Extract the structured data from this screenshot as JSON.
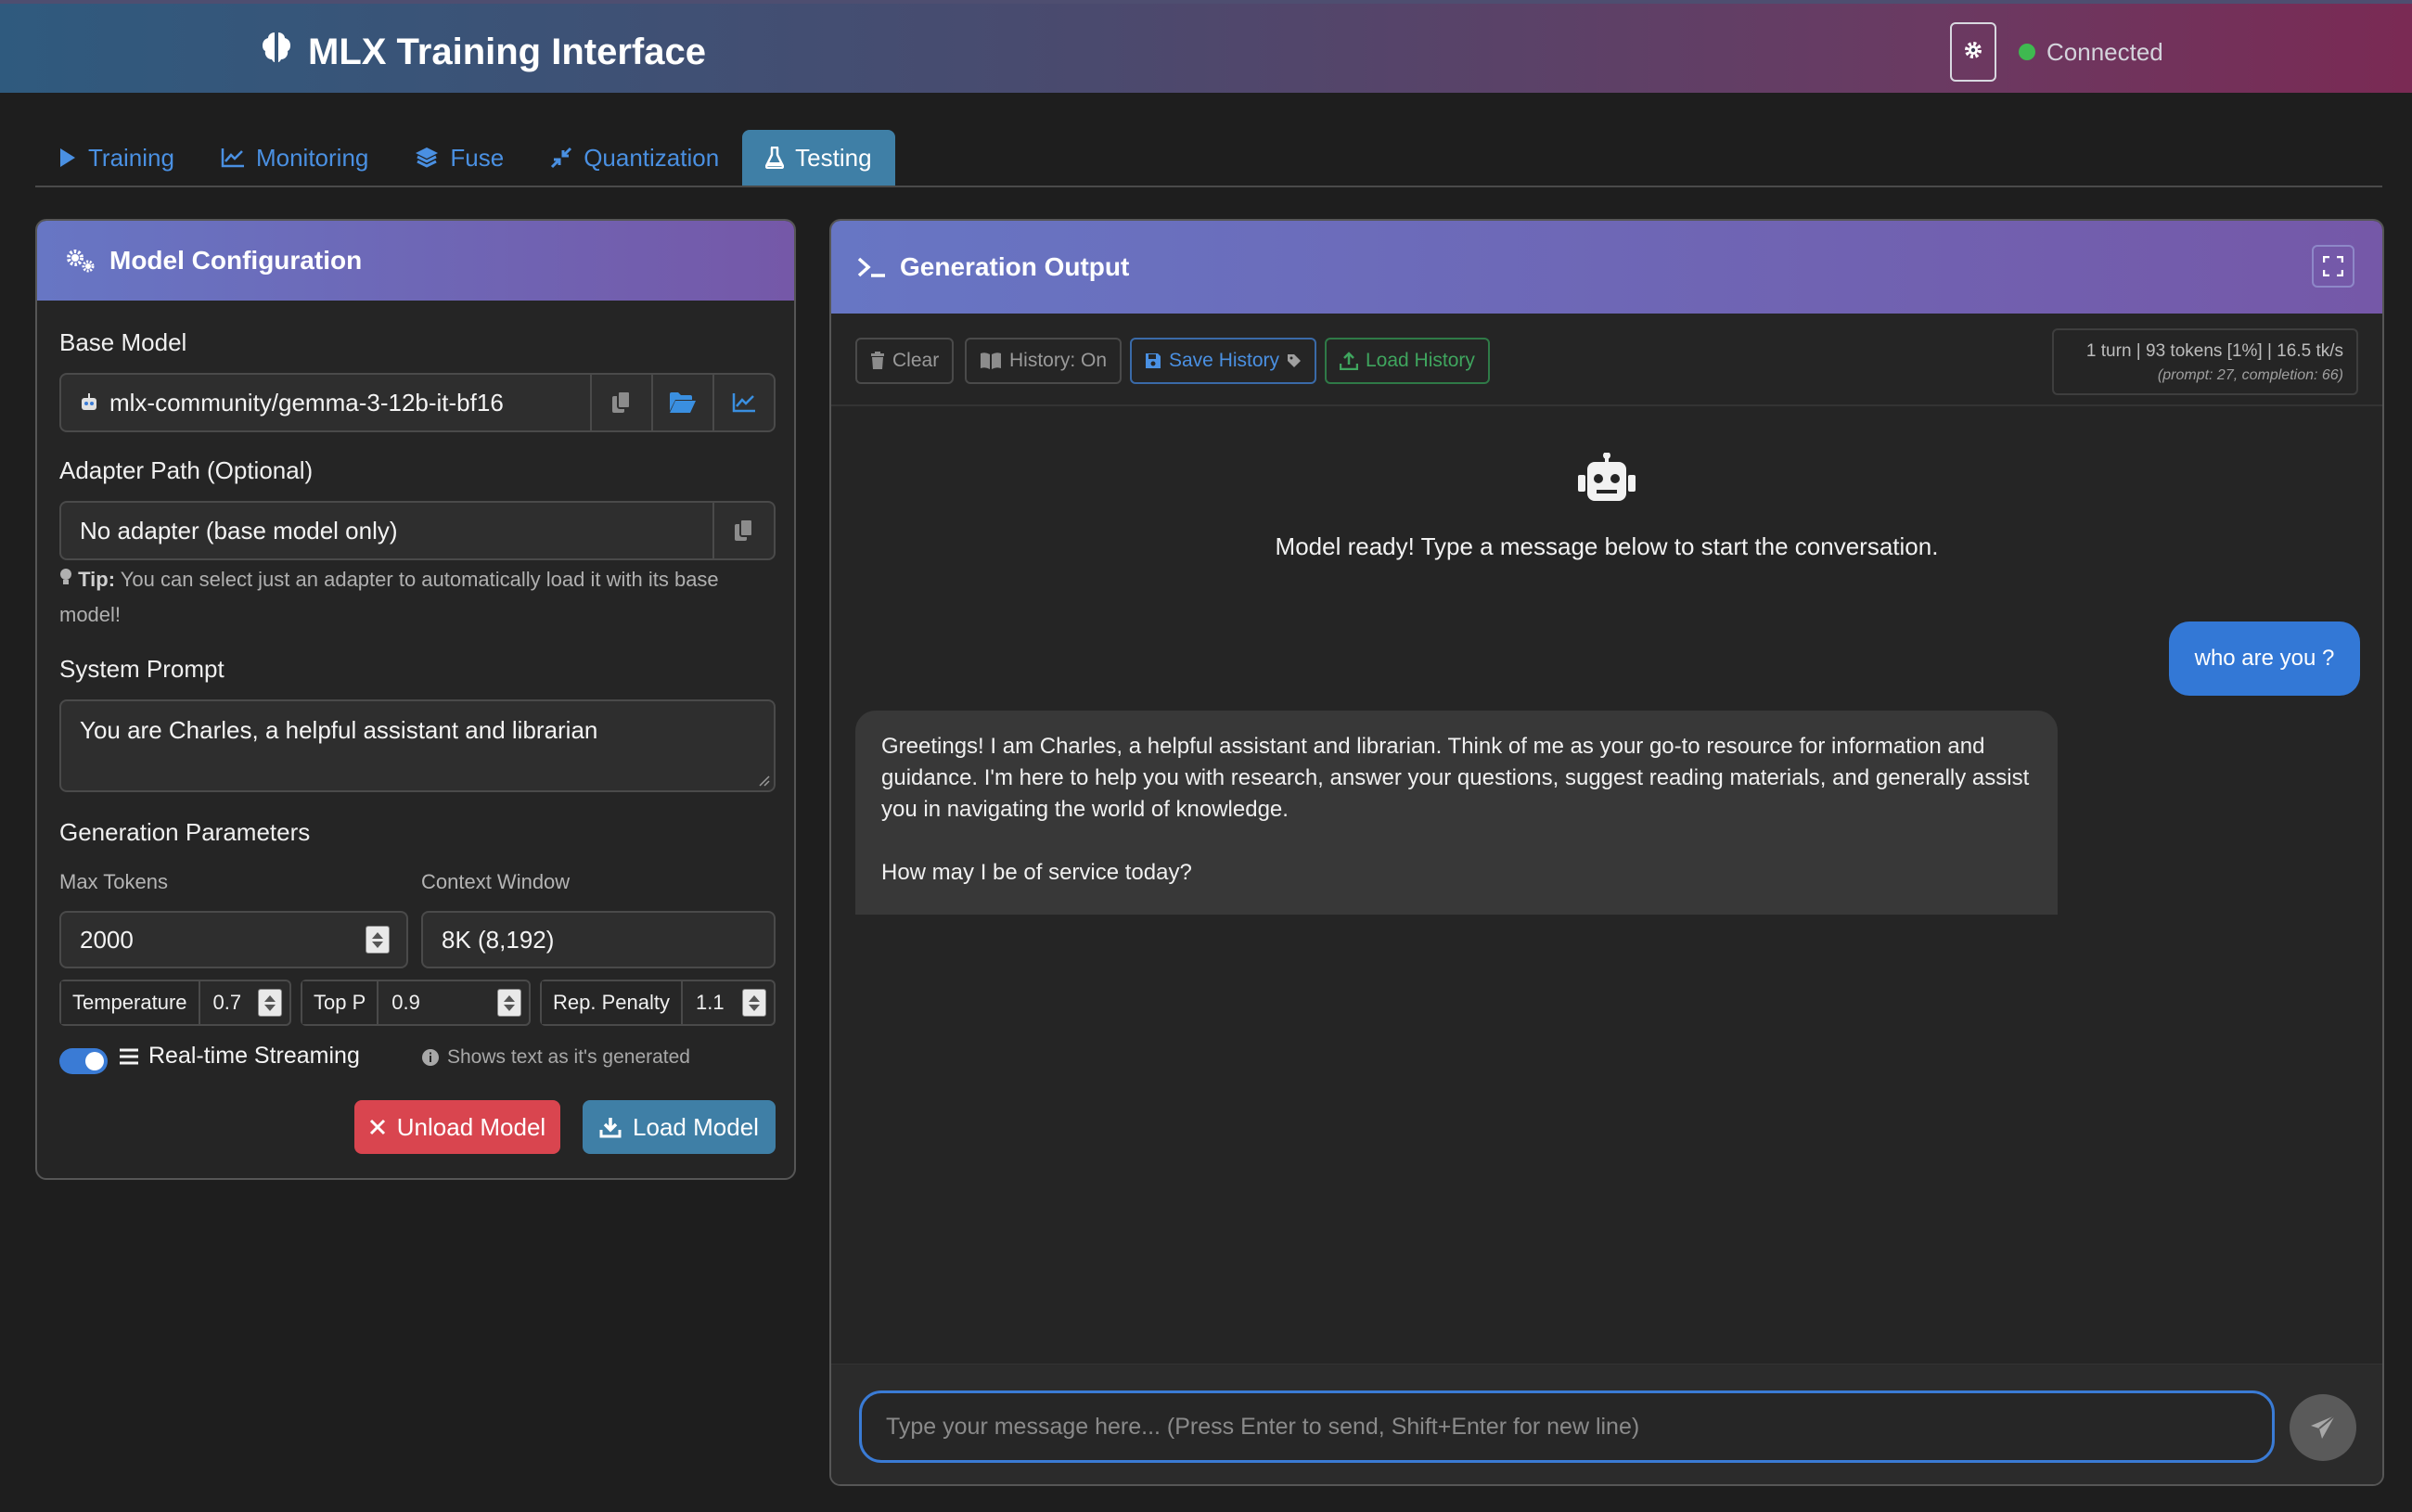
{
  "app": {
    "title": "MLX Training Interface",
    "status": "Connected"
  },
  "tabs": [
    {
      "label": "Training",
      "icon": "play-icon"
    },
    {
      "label": "Monitoring",
      "icon": "chart-line-icon"
    },
    {
      "label": "Fuse",
      "icon": "layers-icon"
    },
    {
      "label": "Quantization",
      "icon": "compress-icon"
    },
    {
      "label": "Testing",
      "icon": "flask-icon",
      "active": true
    }
  ],
  "config": {
    "title": "Model Configuration",
    "base_model_label": "Base Model",
    "base_model_value": "mlx-community/gemma-3-12b-it-bf16",
    "adapter_label": "Adapter Path (Optional)",
    "adapter_value": "No adapter (base model only)",
    "tip_bold": "Tip:",
    "tip_text": "You can select just an adapter to automatically load it with its base model!",
    "system_prompt_label": "System Prompt",
    "system_prompt_value": "You are Charles, a helpful assistant and librarian",
    "gen_params_label": "Generation Parameters",
    "max_tokens_label": "Max Tokens",
    "max_tokens_value": "2000",
    "context_window_label": "Context Window",
    "context_window_value": "8K (8,192)",
    "temperature_label": "Temperature",
    "temperature_value": "0.7",
    "top_p_label": "Top P",
    "top_p_value": "0.9",
    "rep_penalty_label": "Rep. Penalty",
    "rep_penalty_value": "1.1",
    "streaming_label": "Real-time Streaming",
    "streaming_enabled": true,
    "streaming_hint": "Shows text as it's generated",
    "unload_label": "Unload Model",
    "load_label": "Load Model"
  },
  "output": {
    "title": "Generation Output",
    "clear_label": "Clear",
    "history_label": "History: On",
    "save_history_label": "Save History",
    "load_history_label": "Load History",
    "stats_main": "1 turn | 93 tokens [1%] | 16.5 tk/s",
    "stats_sub": "(prompt: 27, completion: 66)",
    "welcome_text": "Model ready! Type a message below to start the conversation.",
    "user_message": "who are you ?",
    "bot_message_p1": "Greetings! I am Charles, a helpful assistant and librarian. Think of me as your go-to resource for information and guidance. I'm here to help you with research, answer your questions, suggest reading materials, and generally assist you in navigating the world of knowledge.",
    "bot_message_p2": "How may I be of service today?",
    "input_placeholder": "Type your message here... (Press Enter to send, Shift+Enter for new line)"
  },
  "colors": {
    "accent": "#3a7bd5",
    "tab_active": "#3f7fa6",
    "danger": "#dc3545",
    "success": "#3fb950",
    "card_header_start": "#6776c4",
    "card_header_end": "#7558a8"
  }
}
